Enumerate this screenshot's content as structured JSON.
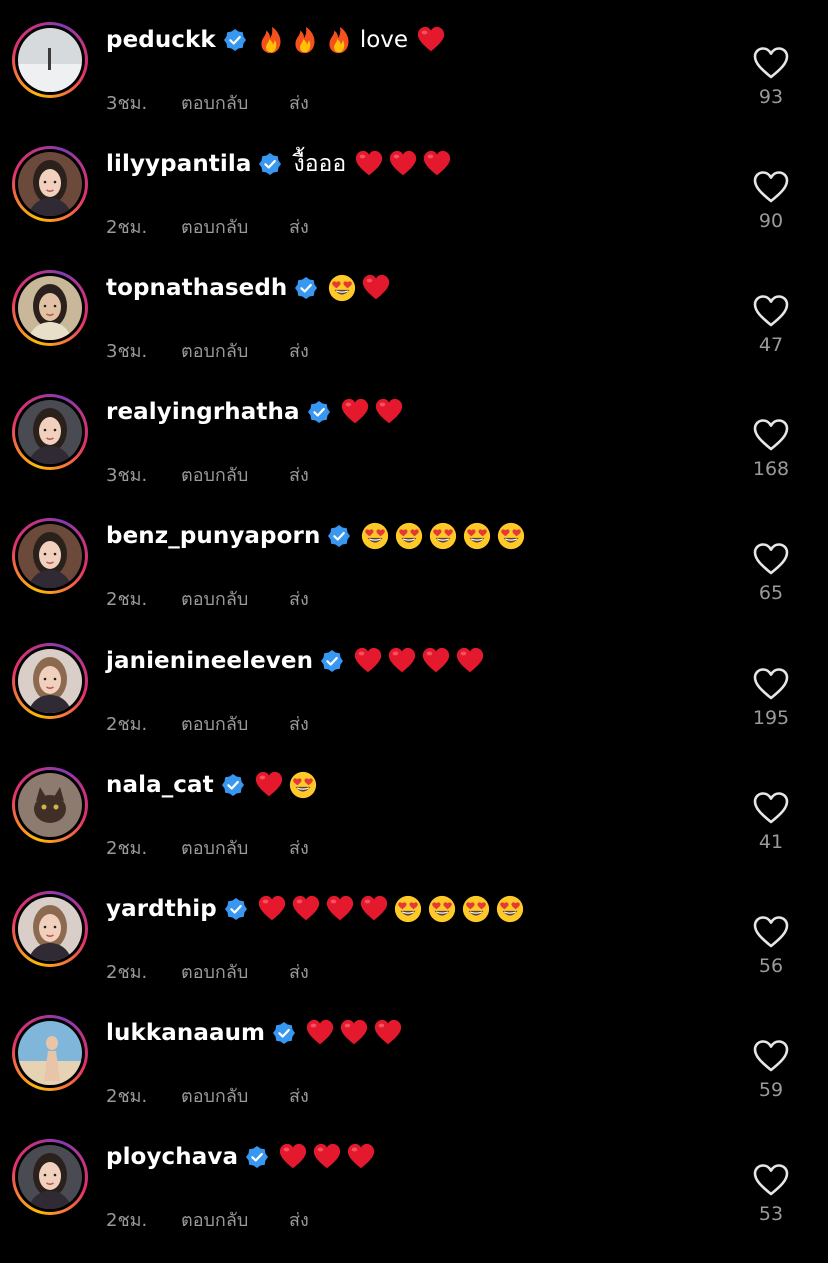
{
  "labels": {
    "reply": "ตอบกลับ",
    "send": "ส่ง"
  },
  "colors": {
    "verified": "#3897f0",
    "heart_emoji": "#e5192e",
    "meta_text": "#9a9a9a"
  },
  "comments": [
    {
      "username": "peduckk",
      "verified": true,
      "prefix_emoji": [
        "fire",
        "fire",
        "fire"
      ],
      "text": "love",
      "suffix_emoji": [
        "red-heart"
      ],
      "time": "3ชม.",
      "likes": "93",
      "avatar": "gray-snow-scene"
    },
    {
      "username": "lilyypantila",
      "verified": true,
      "prefix_emoji": [],
      "text": "งื้อออ",
      "suffix_emoji": [
        "red-heart",
        "red-heart",
        "red-heart"
      ],
      "time": "2ชม.",
      "likes": "90",
      "avatar": "woman-portrait"
    },
    {
      "username": "topnathasedh",
      "verified": true,
      "prefix_emoji": [],
      "text": "",
      "suffix_emoji": [
        "heart-eyes",
        "red-heart"
      ],
      "time": "3ชม.",
      "likes": "47",
      "avatar": "man-portrait"
    },
    {
      "username": "realyingrhatha",
      "verified": true,
      "prefix_emoji": [],
      "text": "",
      "suffix_emoji": [
        "red-heart",
        "red-heart"
      ],
      "time": "3ชม.",
      "likes": "168",
      "avatar": "woman-portrait-dark"
    },
    {
      "username": "benz_punyaporn",
      "verified": true,
      "prefix_emoji": [],
      "text": "",
      "suffix_emoji": [
        "heart-eyes",
        "heart-eyes",
        "heart-eyes",
        "heart-eyes",
        "heart-eyes"
      ],
      "time": "2ชม.",
      "likes": "65",
      "avatar": "woman-portrait"
    },
    {
      "username": "janienineeleven",
      "verified": true,
      "prefix_emoji": [],
      "text": "",
      "suffix_emoji": [
        "red-heart",
        "red-heart",
        "red-heart",
        "red-heart"
      ],
      "time": "2ชม.",
      "likes": "195",
      "avatar": "woman-portrait-light"
    },
    {
      "username": "nala_cat",
      "verified": true,
      "prefix_emoji": [],
      "text": "",
      "suffix_emoji": [
        "red-heart",
        "heart-eyes"
      ],
      "time": "2ชม.",
      "likes": "41",
      "avatar": "cat-photo"
    },
    {
      "username": "yardthip",
      "verified": true,
      "prefix_emoji": [],
      "text": "",
      "suffix_emoji": [
        "red-heart",
        "red-heart",
        "red-heart",
        "red-heart",
        "heart-eyes",
        "heart-eyes",
        "heart-eyes",
        "heart-eyes"
      ],
      "time": "2ชม.",
      "likes": "56",
      "avatar": "woman-portrait-light"
    },
    {
      "username": "lukkanaaum",
      "verified": true,
      "prefix_emoji": [],
      "text": "",
      "suffix_emoji": [
        "red-heart",
        "red-heart",
        "red-heart"
      ],
      "time": "2ชม.",
      "likes": "59",
      "avatar": "beach-photo"
    },
    {
      "username": "ploychava",
      "verified": true,
      "prefix_emoji": [],
      "text": "",
      "suffix_emoji": [
        "red-heart",
        "red-heart",
        "red-heart"
      ],
      "time": "2ชม.",
      "likes": "53",
      "avatar": "woman-portrait-dark"
    }
  ]
}
